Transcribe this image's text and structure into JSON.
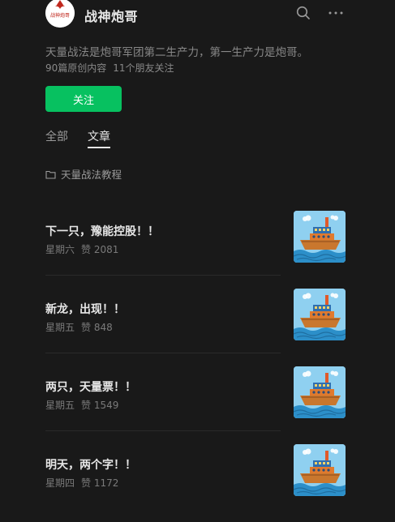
{
  "account": {
    "name": "战神炮哥",
    "logo_text": "战神炮哥",
    "bio": "天量战法是炮哥军团第二生产力，第一生产力是炮哥。",
    "original_count": "90篇原创内容",
    "friends_following": "11个朋友关注",
    "follow_label": "关注"
  },
  "tabs": [
    {
      "label": "全部",
      "active": false
    },
    {
      "label": "文章",
      "active": true
    }
  ],
  "collection": {
    "label": "天量战法教程",
    "icon": "folder-icon"
  },
  "articles": [
    {
      "title": "下一只，豫能控股！！",
      "day": "星期六",
      "likes": "赞 2081"
    },
    {
      "title": "新龙，出现！！",
      "day": "星期五",
      "likes": "赞 848"
    },
    {
      "title": "两只，天量票！！",
      "day": "星期五",
      "likes": "赞 1549"
    },
    {
      "title": "明天，两个字！！",
      "day": "星期四",
      "likes": "赞 1172"
    }
  ],
  "colors": {
    "background": "#191919",
    "accent": "#07c160",
    "text_primary": "#e6e6e6",
    "text_secondary": "#888888"
  }
}
